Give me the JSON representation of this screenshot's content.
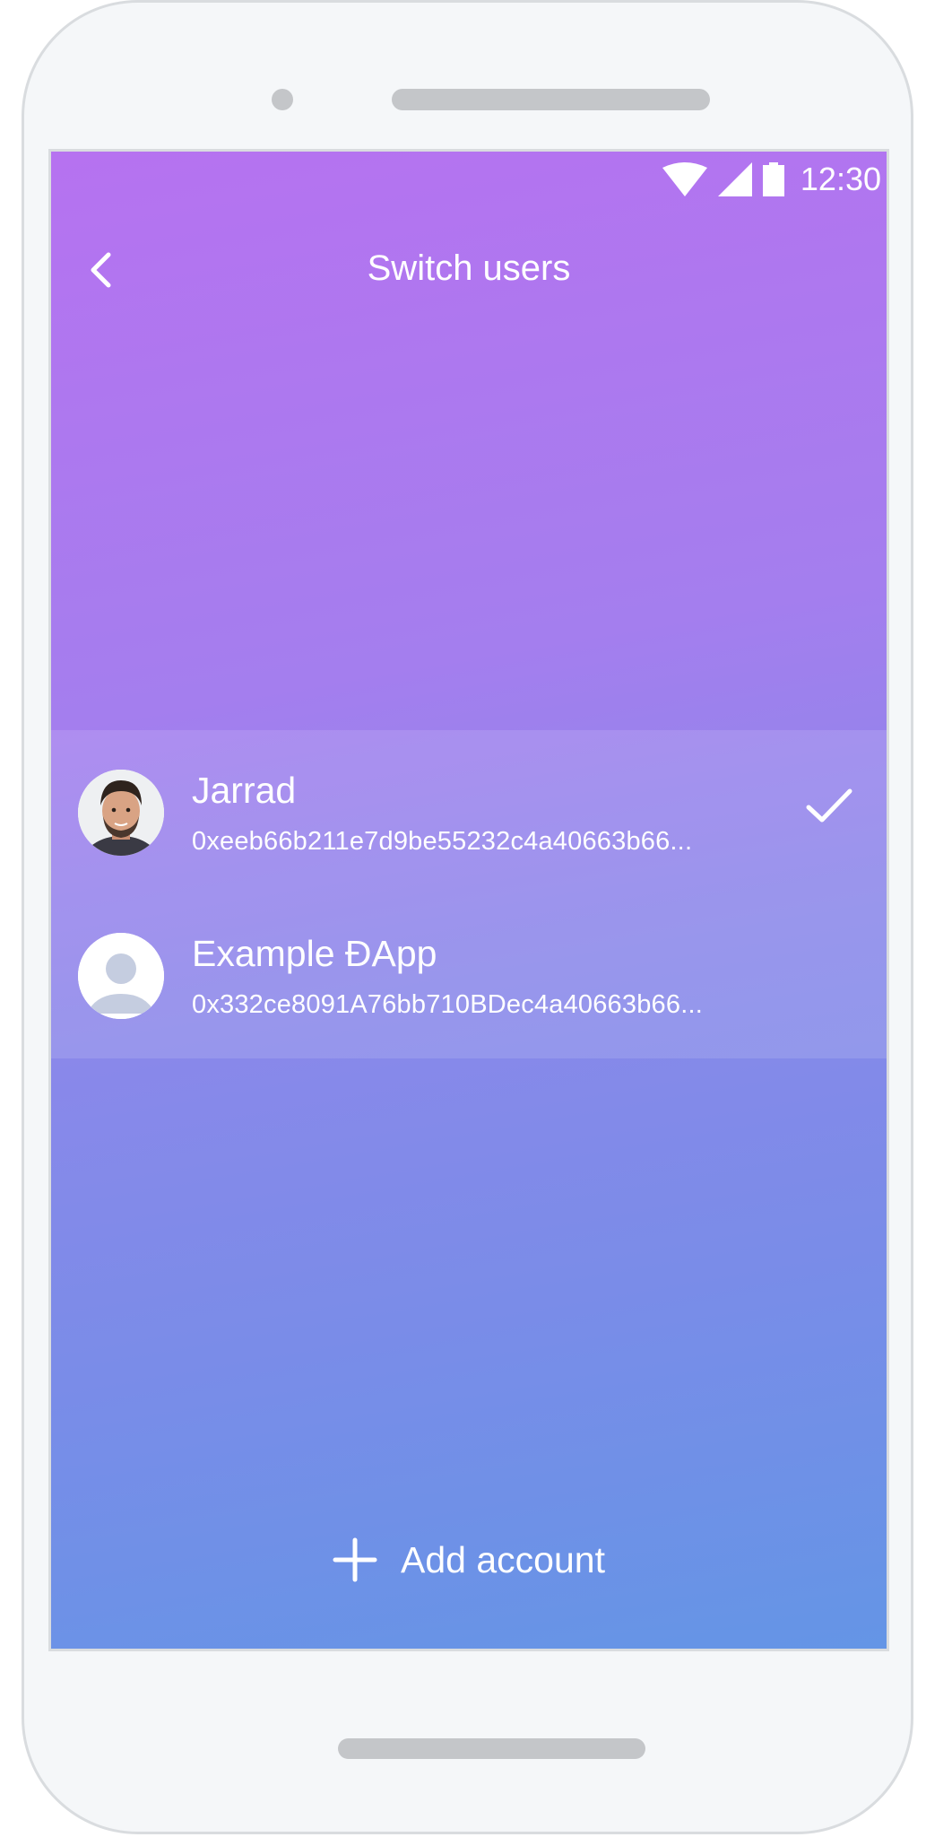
{
  "status_bar": {
    "time": "12:30",
    "icons": [
      "wifi-icon",
      "signal-icon",
      "battery-icon"
    ]
  },
  "header": {
    "title": "Switch users",
    "back_icon": "chevron-left-icon"
  },
  "accounts": [
    {
      "name": "Jarrad",
      "address": "0xeeb66b211e7d9be55232c4a40663b66...",
      "avatar": "user-photo",
      "selected": true
    },
    {
      "name": "Example ĐApp",
      "address": "0x332ce8091A76bb710BDec4a40663b66...",
      "avatar": "default-avatar-icon",
      "selected": false
    }
  ],
  "footer": {
    "add_account_label": "Add account",
    "add_icon": "plus-icon"
  },
  "colors": {
    "gradient_top": "#b672f0",
    "gradient_bottom": "#6495e6",
    "text": "#ffffff"
  }
}
